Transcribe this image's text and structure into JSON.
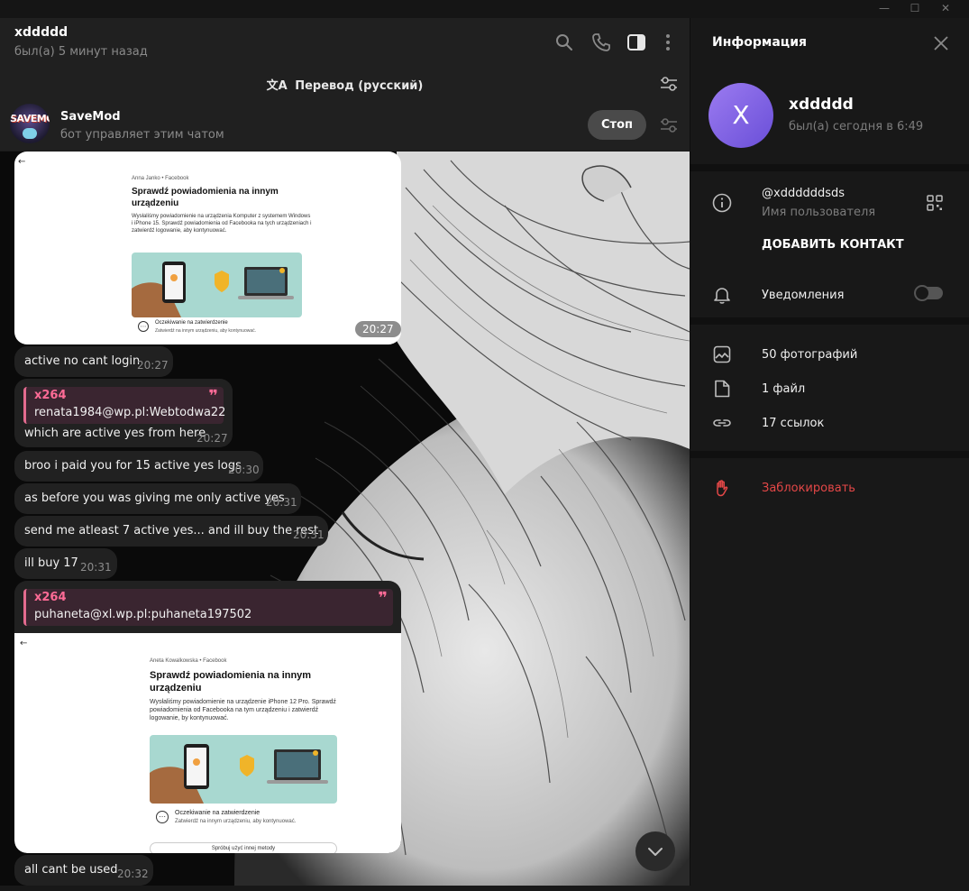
{
  "window": {
    "minimize_label": "—",
    "maximize_label": "☐",
    "close_label": "✕"
  },
  "chat_header": {
    "title": "xddddd",
    "status": "был(а) 5 минут назад"
  },
  "translate_bar": {
    "label": "Перевод (русский)"
  },
  "bot_bar": {
    "avatar_text": "SAVEMOD",
    "name": "SaveMod",
    "subtitle": "бот управляет этим чатом",
    "stop_label": "Стоп"
  },
  "messages": {
    "m1": {
      "time": "20:27",
      "screenshot": {
        "author": "Anna Janko • Facebook",
        "title": "Sprawdź powiadomienia na innym urządzeniu",
        "desc": "Wysłaliśmy powiadomienie na urządzenia Komputer z systemem Windows i iPhone 15. Sprawdź powiadomienia od Facebooka na tych urządzeniach i zatwierdź logowanie, aby kontynuować.",
        "waiting": "Oczekiwanie na zatwierdzenie",
        "waiting_sub": "Zatwierdź na innym urządzeniu, aby kontynuować."
      }
    },
    "m2": {
      "text": "active no cant login",
      "time": "20:27"
    },
    "m3": {
      "quote_name": "x264",
      "quote_text": "renata1984@wp.pl:Webtodwa22",
      "text": "which are active yes from here",
      "time": "20:27"
    },
    "m4": {
      "text": "broo i paid you for 15 active yes logs",
      "time": "20:30"
    },
    "m5": {
      "text": "as before you was giving me only active yes",
      "time": "20:31"
    },
    "m6": {
      "text": "send me atleast 7 active yes... and ill buy the rest",
      "time": "20:31"
    },
    "m7": {
      "text": "ill buy 17",
      "time": "20:31"
    },
    "m8": {
      "quote_name": "x264",
      "quote_text": "puhaneta@xl.wp.pl:puhaneta197502",
      "screenshot": {
        "author": "Aneta Kowalkowska • Facebook",
        "title": "Sprawdź powiadomienia na innym urządzeniu",
        "desc": "Wysłaliśmy powiadomienie na urządzenie iPhone 12 Pro. Sprawdź powiadomienia od Facebooka na tym urządzeniu i zatwierdź logowanie, by kontynuować.",
        "waiting": "Oczekiwanie na zatwierdzenie",
        "waiting_sub": "Zatwierdź na innym urządzeniu, aby kontynuować.",
        "other_method": "Spróbuj użyć innej metody"
      }
    },
    "m9": {
      "text": "all cant be used",
      "time": "20:32"
    }
  },
  "info_panel": {
    "title": "Информация",
    "avatar_letter": "X",
    "name": "xddddd",
    "seen": "был(а) сегодня в 6:49",
    "username": "@xddddddsds",
    "username_label": "Имя пользователя",
    "add_contact": "ДОБАВИТЬ КОНТАКТ",
    "notifications": "Уведомления",
    "notifications_on": false,
    "photos": "50 фотографий",
    "files": "1 файл",
    "links": "17 ссылок",
    "block": "Заблокировать"
  },
  "colors": {
    "accent_avatar": "#8a6cf0",
    "quote_accent": "#ff6b96",
    "danger": "#e34747"
  },
  "icons": [
    "search-icon",
    "phone-icon",
    "sidebar-toggle-icon",
    "more-icon",
    "translate-icon",
    "settings-sliders-icon",
    "close-icon",
    "info-icon",
    "qr-code-icon",
    "bell-icon",
    "photo-icon",
    "file-icon",
    "link-icon",
    "hand-block-icon",
    "chevron-down-icon"
  ]
}
